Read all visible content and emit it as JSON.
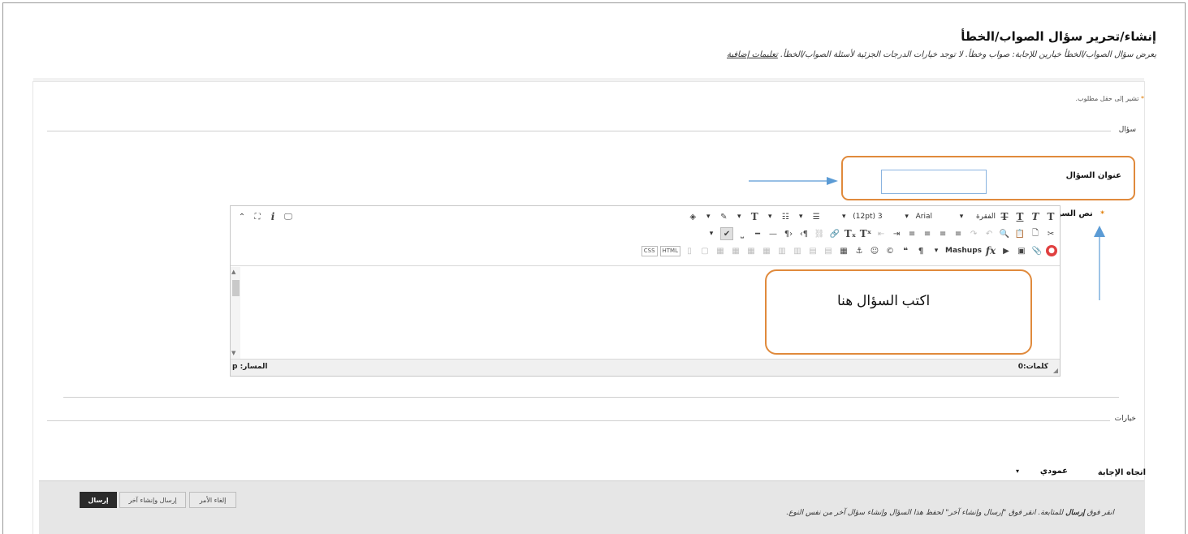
{
  "page": {
    "title": "إنشاء/تحرير سؤال الصواب/الخطأ",
    "description": "يعرض سؤال الصواب/الخطأ خيارين للإجابة: صواب وخطأ. لا توجد خيارات الدرجات الجزئية لأسئلة الصواب/الخطأ.",
    "more_link": "تعليمات إضافية"
  },
  "required_note": {
    "star": "*",
    "text": "تشير إلى حقل مطلوب."
  },
  "question_section": {
    "label": "سؤال",
    "title_label": "عنوان السؤال",
    "title_value": "",
    "text_label": "نص السؤال",
    "required_star": "*"
  },
  "editor": {
    "toolbar_row1": {
      "paragraph": "الفقرة",
      "font": "Arial",
      "size": "3 (12pt)"
    },
    "toolbar_row3": {
      "mashups": "Mashups",
      "html": "HTML",
      "css": "CSS"
    },
    "status": {
      "path": "المسار: p",
      "words": "كلمات:0"
    }
  },
  "annotation": {
    "hint": "اكتب السؤال هنا",
    "accent_color": "#e08a3c",
    "arrow_color": "#5b9bd5"
  },
  "options_section": {
    "label": "خيارات",
    "answer_direction_label": "اتجاه الإجابة",
    "answer_direction_value": "عمودي"
  },
  "footer": {
    "note_prefix": "انقر فوق",
    "note_submit": "إرسال",
    "note_rest": "للمتابعة. انقر فوق \"إرسال وإنشاء آخر\" لحفظ هذا السؤال وإنشاء سؤال آخر من نفس النوع.",
    "cancel_label": "إلغاء الأمر",
    "submit_create_label": "إرسال وإنشاء آخر",
    "submit_label": "إرسال"
  }
}
